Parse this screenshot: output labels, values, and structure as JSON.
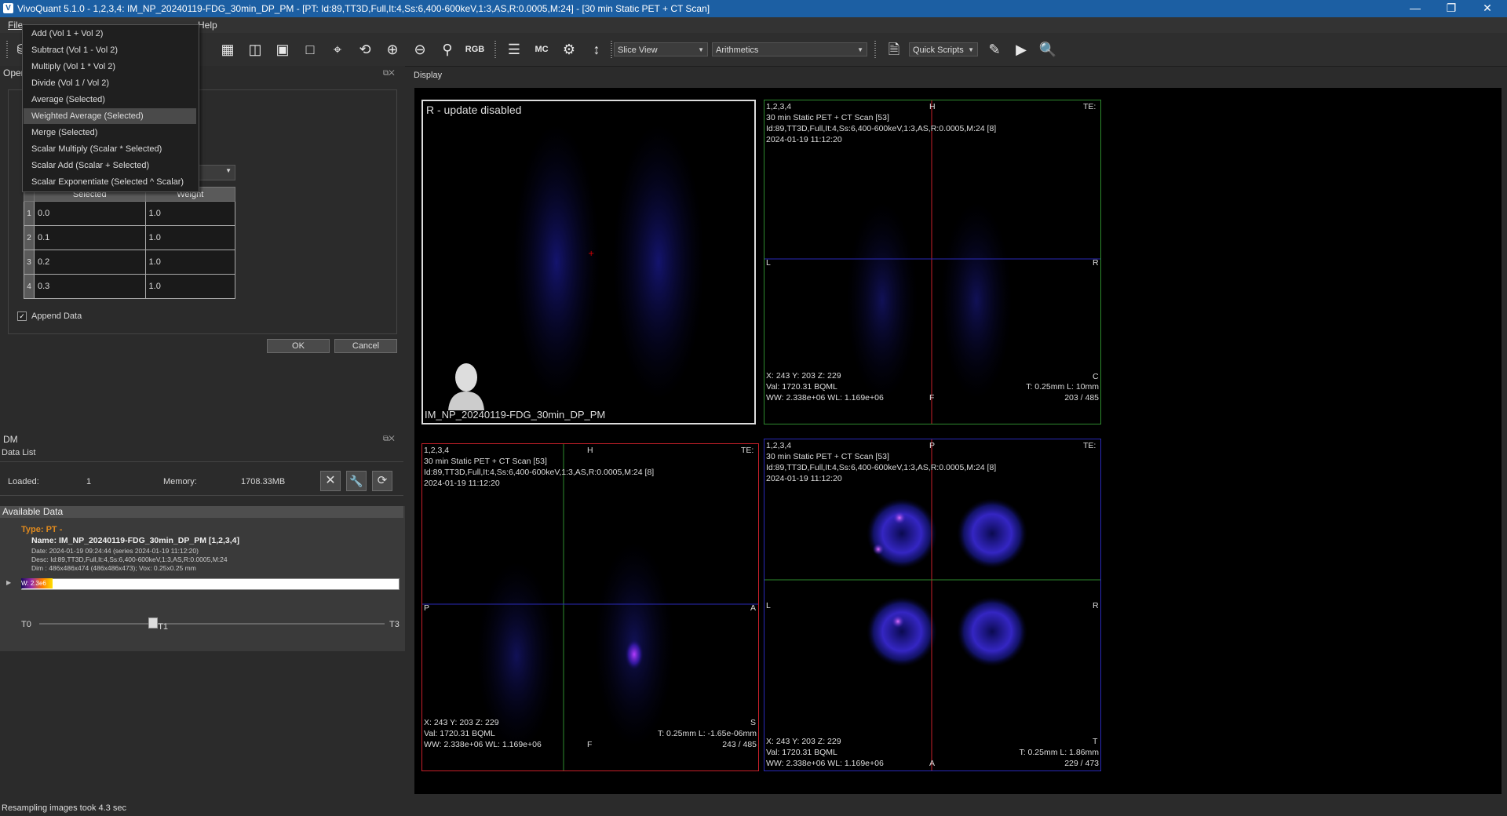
{
  "title_bar": {
    "title": "VivoQuant 5.1.0 - 1,2,3,4: IM_NP_20240119-FDG_30min_DP_PM - [PT: Id:89,TT3D,Full,It:4,Ss:6,400-600keV,1:3,AS,R:0.0005,M:24] - [30 min Static PET + CT Scan]"
  },
  "menu": {
    "file": "File",
    "visible_tail": "Help"
  },
  "toolbar": {
    "slice_view": "Slice View",
    "arithmetics": "Arithmetics",
    "quick_scripts": "Quick Scripts"
  },
  "dropdown": {
    "items": [
      "Add (Vol 1 + Vol 2)",
      "Subtract (Vol 1 - Vol 2)",
      "Multiply (Vol 1 * Vol 2)",
      "Divide (Vol 1 / Vol 2)",
      "Average (Selected)",
      "Weighted Average (Selected)",
      "Merge (Selected)",
      "Scalar Multiply (Scalar * Selected)",
      "Scalar Add (Scalar + Selected)",
      "Scalar Exponentiate (Selected ^ Scalar)"
    ],
    "highlighted_index": 5
  },
  "operator_panel": {
    "title": "Oper",
    "table": {
      "headers": [
        "Selected",
        "Weight"
      ],
      "rows": [
        {
          "n": "1",
          "selected": "0.0",
          "weight": "1.0"
        },
        {
          "n": "2",
          "selected": "0.1",
          "weight": "1.0"
        },
        {
          "n": "3",
          "selected": "0.2",
          "weight": "1.0"
        },
        {
          "n": "4",
          "selected": "0.3",
          "weight": "1.0"
        }
      ]
    },
    "append_data": "Append Data",
    "ok": "OK",
    "cancel": "Cancel"
  },
  "dm": {
    "title": "DM",
    "data_list": "Data List",
    "loaded_label": "Loaded:",
    "loaded_value": "1",
    "memory_label": "Memory:",
    "memory_value": "1708.33MB",
    "available_data": "Available Data",
    "type": "Type: PT -",
    "name": "Name: IM_NP_20240119-FDG_30min_DP_PM [1,2,3,4]",
    "date": "Date: 2024-01-19 09:24:44 (series 2024-01-19 11:12:20)",
    "desc": "Desc: Id:89,TT3D,Full,It:4,Ss:6,400-600keV,1:3,AS,R:0.0005,M:24",
    "dim": "Dim : 486x486x474 (486x486x473); Vox: 0.25x0.25 mm",
    "colorbar_label": "W: 2.3e6",
    "t0": "T0",
    "t1": "T1",
    "t3": "T3",
    "timeline_position": 0.33
  },
  "display": {
    "label": "Display",
    "render_view": {
      "header": "R - update disabled",
      "footer": "IM_NP_20240119-FDG_30min_DP_PM"
    },
    "coronal": {
      "ids": "1,2,3,4",
      "scan": "30 min Static PET + CT Scan [53]",
      "params": "Id:89,TT3D,Full,It:4,Ss:6,400-600keV,1:3,AS,R:0.0005,M:24 [8]",
      "datetime": "2024-01-19 11:12:20",
      "top": "H",
      "left": "L",
      "right": "R",
      "bottom": "F",
      "corner": "C",
      "te": "TE:",
      "xyz": "X: 243 Y: 203 Z: 229",
      "val": "Val: 1720.31 BQML",
      "ww": "WW: 2.338e+06 WL: 1.169e+06",
      "tl": "T: 0.25mm L: 10mm",
      "slice": "203 / 485"
    },
    "sagittal": {
      "ids": "1,2,3,4",
      "scan": "30 min Static PET + CT Scan [53]",
      "params": "Id:89,TT3D,Full,It:4,Ss:6,400-600keV,1:3,AS,R:0.0005,M:24 [8]",
      "datetime": "2024-01-19 11:12:20",
      "top": "H",
      "left": "P",
      "right": "A",
      "bottom": "F",
      "corner": "S",
      "te": "TE:",
      "xyz": "X: 243 Y: 203 Z: 229",
      "val": "Val: 1720.31 BQML",
      "ww": "WW: 2.338e+06 WL: 1.169e+06",
      "tl": "T: 0.25mm L: -1.65e-06mm",
      "slice": "243 / 485"
    },
    "transverse": {
      "ids": "1,2,3,4",
      "scan": "30 min Static PET + CT Scan [53]",
      "params": "Id:89,TT3D,Full,It:4,Ss:6,400-600keV,1:3,AS,R:0.0005,M:24 [8]",
      "datetime": "2024-01-19 11:12:20",
      "top": "P",
      "left": "L",
      "right": "R",
      "bottom": "A",
      "corner": "T",
      "te": "TE:",
      "xyz": "X: 243 Y: 203 Z: 229",
      "val": "Val: 1720.31 BQML",
      "ww": "WW: 2.338e+06 WL: 1.169e+06",
      "tl": "T: 0.25mm L: 1.86mm",
      "slice": "229 / 473"
    }
  },
  "status_bar": {
    "message": "Resampling images took 4.3 sec"
  },
  "colors": {
    "title_bar": "#1c5fa3",
    "type_label": "#e08a1e",
    "coronal_border": "#2e8b2e",
    "sagittal_border": "#c8202a",
    "transverse_border": "#2a2ab8",
    "pet_glow": "#1a1a8a"
  }
}
